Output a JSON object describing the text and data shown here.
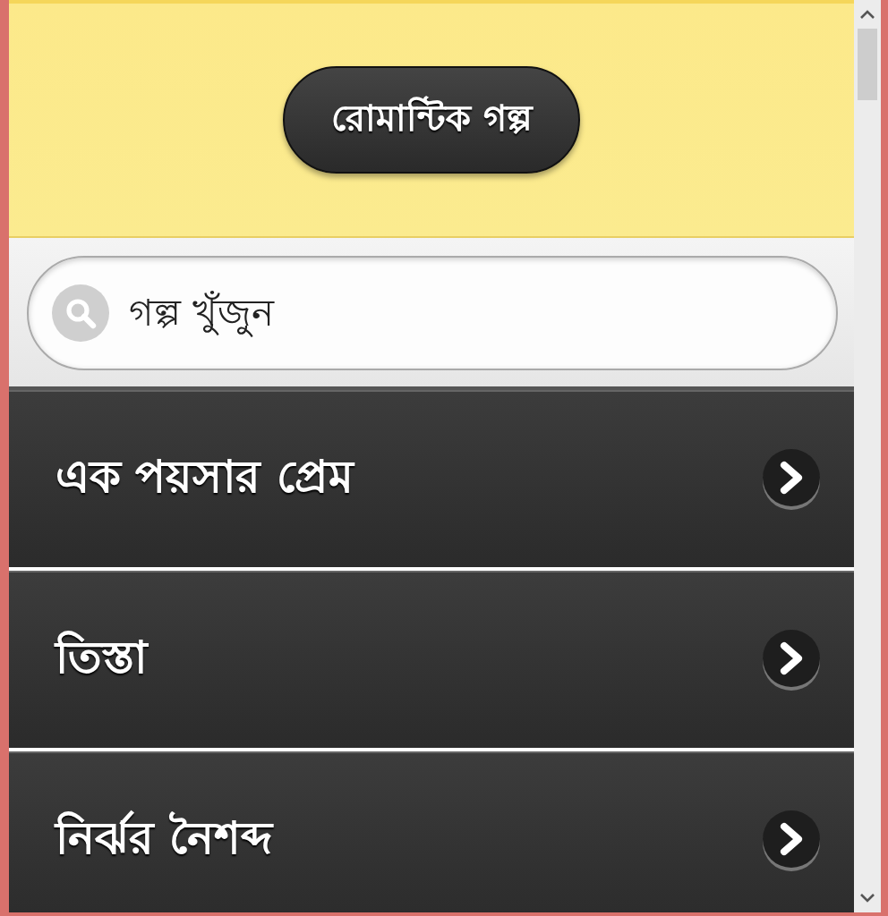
{
  "header": {
    "title": "রোমান্টিক গল্প"
  },
  "search": {
    "placeholder": "গল্প খুঁজুন"
  },
  "stories": [
    {
      "title": "এক পয়সার প্রেম"
    },
    {
      "title": "তিস্তা"
    },
    {
      "title": "নির্ঝর নৈশব্দ"
    }
  ]
}
